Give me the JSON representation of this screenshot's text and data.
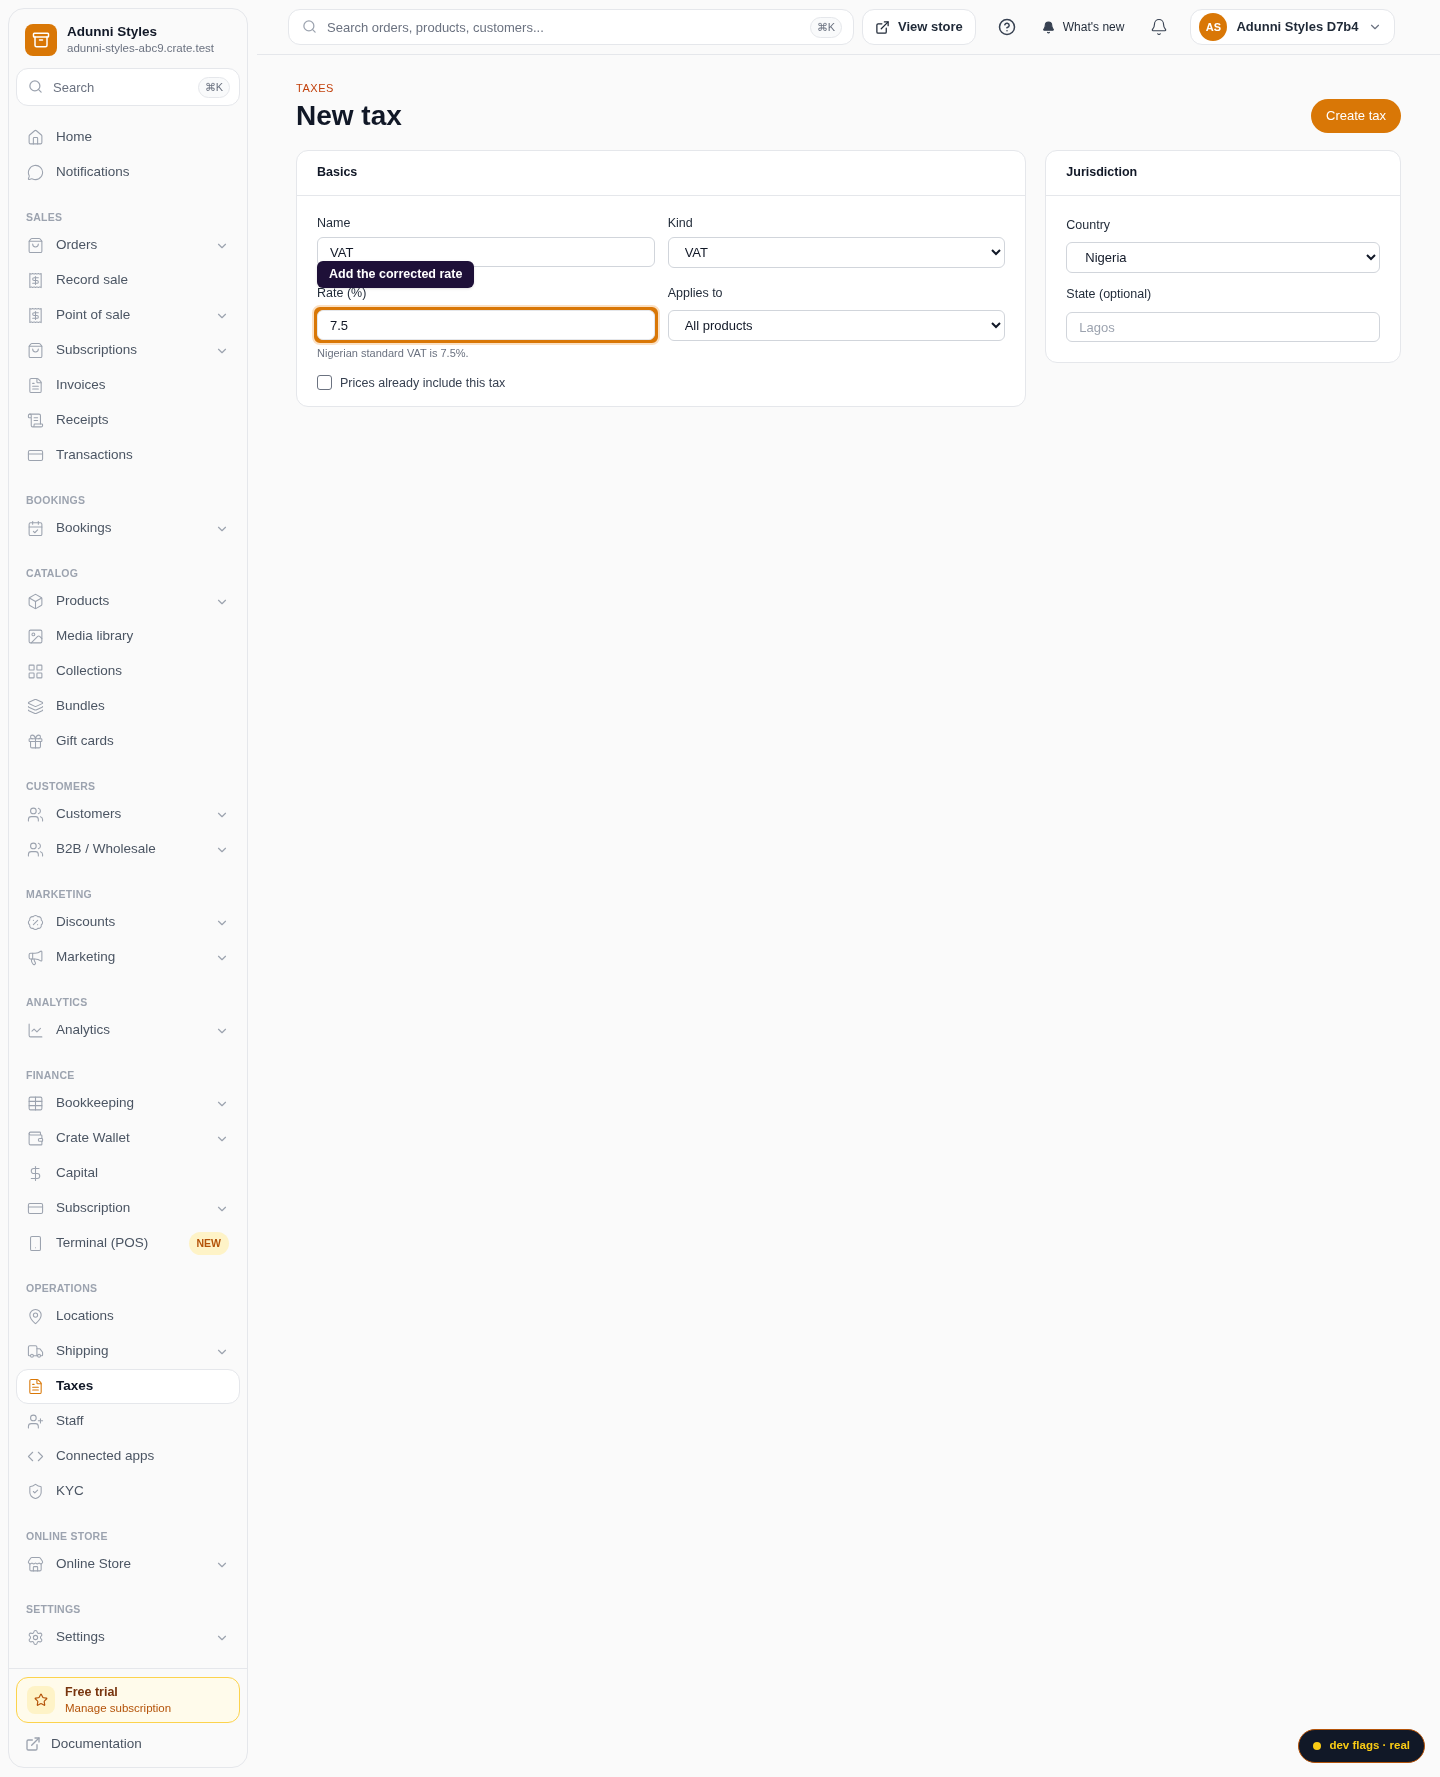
{
  "store": {
    "name": "Adunni Styles",
    "domain": "adunni-styles-abc9.crate.test"
  },
  "sidebar_search": {
    "placeholder": "Search",
    "shortcut": "⌘K"
  },
  "sidebar": [
    {
      "items": [
        {
          "label": "Home",
          "selected": false,
          "has_submenu": false
        },
        {
          "label": "Notifications",
          "selected": false,
          "has_submenu": false
        }
      ]
    },
    {
      "heading": "SALES",
      "items": [
        {
          "label": "Orders",
          "selected": false,
          "has_submenu": true
        },
        {
          "label": "Record sale",
          "selected": false,
          "has_submenu": false
        },
        {
          "label": "Point of sale",
          "selected": false,
          "has_submenu": true
        },
        {
          "label": "Subscriptions",
          "selected": false,
          "has_submenu": true
        },
        {
          "label": "Invoices",
          "selected": false,
          "has_submenu": false
        },
        {
          "label": "Receipts",
          "selected": false,
          "has_submenu": false
        },
        {
          "label": "Transactions",
          "selected": false,
          "has_submenu": false
        }
      ]
    },
    {
      "heading": "BOOKINGS",
      "items": [
        {
          "label": "Bookings",
          "selected": false,
          "has_submenu": true
        }
      ]
    },
    {
      "heading": "CATALOG",
      "items": [
        {
          "label": "Products",
          "selected": false,
          "has_submenu": true
        },
        {
          "label": "Media library",
          "selected": false,
          "has_submenu": false
        },
        {
          "label": "Collections",
          "selected": false,
          "has_submenu": false
        },
        {
          "label": "Bundles",
          "selected": false,
          "has_submenu": false
        },
        {
          "label": "Gift cards",
          "selected": false,
          "has_submenu": false
        }
      ]
    },
    {
      "heading": "CUSTOMERS",
      "items": [
        {
          "label": "Customers",
          "selected": false,
          "has_submenu": true
        },
        {
          "label": "B2B / Wholesale",
          "selected": false,
          "has_submenu": true
        }
      ]
    },
    {
      "heading": "MARKETING",
      "items": [
        {
          "label": "Discounts",
          "selected": false,
          "has_submenu": true
        },
        {
          "label": "Marketing",
          "selected": false,
          "has_submenu": true
        }
      ]
    },
    {
      "heading": "ANALYTICS",
      "items": [
        {
          "label": "Analytics",
          "selected": false,
          "has_submenu": true
        }
      ]
    },
    {
      "heading": "FINANCE",
      "items": [
        {
          "label": "Bookkeeping",
          "selected": false,
          "has_submenu": true
        },
        {
          "label": "Crate Wallet",
          "selected": false,
          "has_submenu": true
        },
        {
          "label": "Capital",
          "selected": false,
          "has_submenu": false
        },
        {
          "label": "Subscription",
          "selected": false,
          "has_submenu": true
        },
        {
          "label": "Terminal (POS)",
          "selected": false,
          "has_submenu": false,
          "badge": "NEW"
        }
      ]
    },
    {
      "heading": "OPERATIONS",
      "items": [
        {
          "label": "Locations",
          "selected": false,
          "has_submenu": false
        },
        {
          "label": "Shipping",
          "selected": false,
          "has_submenu": true
        },
        {
          "label": "Taxes",
          "selected": true,
          "has_submenu": false
        },
        {
          "label": "Staff",
          "selected": false,
          "has_submenu": false
        },
        {
          "label": "Connected apps",
          "selected": false,
          "has_submenu": false
        },
        {
          "label": "KYC",
          "selected": false,
          "has_submenu": false
        }
      ]
    },
    {
      "heading": "ONLINE STORE",
      "items": [
        {
          "label": "Online Store",
          "selected": false,
          "has_submenu": true
        }
      ]
    },
    {
      "heading": "SETTINGS",
      "items": [
        {
          "label": "Settings",
          "selected": false,
          "has_submenu": true
        }
      ]
    }
  ],
  "trial": {
    "title": "Free trial",
    "link": "Manage subscription"
  },
  "documentation": "Documentation",
  "topbar": {
    "search_placeholder": "Search orders, products, customers...",
    "shortcut": "⌘K",
    "view_store": "View store",
    "whats_new": "What's new",
    "user_initials": "AS",
    "user_name": "Adunni Styles D7b4"
  },
  "breadcrumb": "TAXES",
  "title": "New tax",
  "create_button": "Create tax",
  "basics": {
    "title": "Basics",
    "name_label": "Name",
    "name_value": "VAT",
    "kind_label": "Kind",
    "kind_value": "VAT",
    "rate_label": "Rate (%)",
    "rate_value": "7.5",
    "rate_focused": true,
    "rate_hint": "Nigerian standard VAT is 7.5%.",
    "applies_label": "Applies to",
    "applies_value": "All products",
    "inclusive_label": "Prices already include this tax",
    "inclusive_checked": false
  },
  "tooltip": "Add the corrected rate",
  "jurisdiction": {
    "title": "Jurisdiction",
    "country_label": "Country",
    "country_value": "Nigeria",
    "state_label": "State (optional)",
    "state_placeholder": "Lagos"
  },
  "dev_badge": "dev flags · real"
}
